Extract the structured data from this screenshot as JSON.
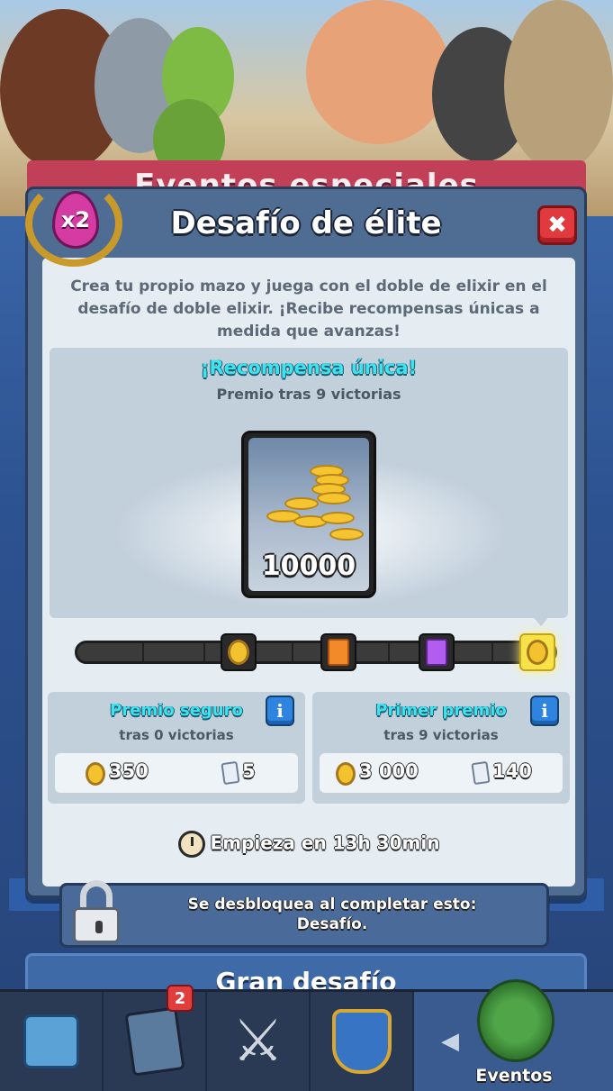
{
  "background": {
    "banner_title": "Eventos especiales",
    "lower_card_title": "Gran desafío"
  },
  "modal": {
    "badge": "x2",
    "title": "Desafío de élite",
    "close_icon": "close-x",
    "description": "Crea tu propio mazo y juega con el doble de elixir en el desafío de doble elixir. ¡Recibe recompensas únicas a medida que avanzas!",
    "unique_reward": {
      "title": "¡Recompensa única!",
      "subtitle": "Premio tras 9 victorias",
      "amount": "10000",
      "icon": "gold-coins"
    },
    "progress": {
      "wins": 0,
      "max_wins": 9,
      "milestones": [
        "gold-coin",
        "orange-card",
        "purple-card",
        "gold-coin-final"
      ]
    },
    "safe_prize": {
      "title": "Premio seguro",
      "subtitle": "tras 0 victorias",
      "gold": "350",
      "cards": "5"
    },
    "first_prize": {
      "title": "Primer premio",
      "subtitle": "tras 9 victorias",
      "gold": "3 000",
      "cards": "140"
    },
    "starts_in": "Empieza en 13h 30min"
  },
  "locked": {
    "line1": "Se desbloquea al completar esto:",
    "line2": "Desafío."
  },
  "nav": {
    "cards_badge": "2",
    "events_label": "Eventos"
  },
  "colors": {
    "accent_cyan": "#3fe2ee",
    "close_red": "#e03a3e",
    "info_blue": "#2f84e0",
    "elixir_pink": "#d43ba3"
  }
}
